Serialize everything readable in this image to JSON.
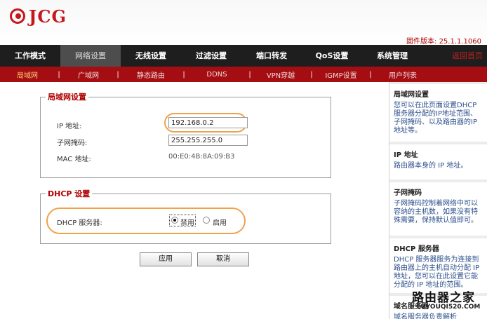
{
  "brand": {
    "name": "JCG"
  },
  "firmware": "固件版本: 25.1.1.1060",
  "nav": {
    "items": [
      {
        "label": "工作模式"
      },
      {
        "label": "网络设置",
        "active": true
      },
      {
        "label": "无线设置"
      },
      {
        "label": "过滤设置"
      },
      {
        "label": "端口转发"
      },
      {
        "label": "QoS设置"
      },
      {
        "label": "系统管理"
      }
    ],
    "homepage": "返回首页"
  },
  "subnav": {
    "items": [
      {
        "label": "局域网",
        "active": true
      },
      {
        "label": "广域网"
      },
      {
        "label": "静态路由"
      },
      {
        "label": "DDNS"
      },
      {
        "label": "VPN穿越"
      },
      {
        "label": "IGMP设置"
      },
      {
        "label": "用户列表"
      }
    ]
  },
  "lan": {
    "legend": "局域网设置",
    "ip_label": "IP 地址:",
    "ip_value": "192.168.0.2",
    "mask_label": "子网掩码:",
    "mask_value": "255.255.255.0",
    "mac_label": "MAC 地址:",
    "mac_value": "00:E0:4B:8A:09:B3"
  },
  "dhcp": {
    "legend": "DHCP 设置",
    "server_label": "DHCP 服务器:",
    "disable_label": "禁用",
    "enable_label": "启用",
    "selected": "disable"
  },
  "buttons": {
    "apply": "应用",
    "cancel": "取消"
  },
  "help": [
    {
      "title": "局域网设置",
      "text": "您可以在此页面设置DHCP服务器分配的IP地址范围、子网掩码、以及路由器的IP地址等。"
    },
    {
      "title": "IP 地址",
      "text": "路由器本身的 IP 地址。"
    },
    {
      "title": "子网掩码",
      "text": "子网掩码控制着网络中可以容纳的主机数，如果没有特殊需要，保持默认值即可。"
    },
    {
      "title": "DHCP 服务器",
      "text": "DHCP 服务器服务为连接到路由器上的主机自动分配 IP 地址，您可以在此设置它能分配的 IP 地址的范围。"
    },
    {
      "title": "域名服务器",
      "text": "域名服务器负责解析"
    }
  ],
  "watermark": {
    "title": "路由器之家",
    "url": "LUYOUQI520.COM"
  },
  "colors": {
    "brand_red": "#c8161e",
    "nav_bg": "#1e1e1e",
    "subnav_bg": "#a40d12",
    "highlight_ring": "#f0a24a",
    "help_text": "#2d4f8c"
  }
}
